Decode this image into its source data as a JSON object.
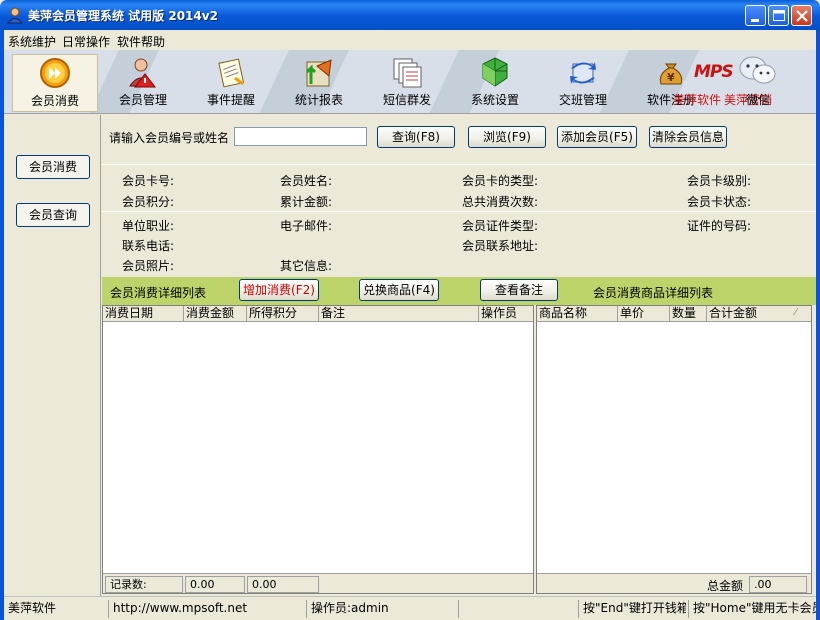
{
  "window": {
    "title": "美萍会员管理系统 试用版  2014v2"
  },
  "menu": [
    "系统维护",
    "日常操作",
    "软件帮助"
  ],
  "toolbar": {
    "buttons": [
      {
        "label": "会员消费",
        "icon": "play-circle-icon"
      },
      {
        "label": "会员管理",
        "icon": "warning-user-icon"
      },
      {
        "label": "事件提醒",
        "icon": "notepad-icon"
      },
      {
        "label": "统计报表",
        "icon": "report-arrow-icon"
      },
      {
        "label": "短信群发",
        "icon": "document-stack-icon"
      },
      {
        "label": "系统设置",
        "icon": "green-cubes-icon"
      },
      {
        "label": "交班管理",
        "icon": "exchange-arrows-icon"
      },
      {
        "label": "软件注册",
        "icon": "money-bag-icon"
      }
    ],
    "brand_logo": "MPS",
    "red_labels": [
      "美萍软件",
      "美萍营销"
    ],
    "wechat_label": "微信"
  },
  "sidebar": {
    "items": [
      "会员消费",
      "会员查询"
    ]
  },
  "search": {
    "label": "请输入会员编号或姓名",
    "value": "",
    "query_btn": "查询(F8)",
    "browse_btn": "浏览(F9)",
    "add_btn": "添加会员(F5)",
    "clear_btn": "清除会员信息"
  },
  "member_fields": {
    "card_no": "会员卡号:",
    "name": "会员姓名:",
    "card_type": "会员卡的类型:",
    "card_level": "会员卡级别:",
    "points": "会员积分:",
    "total_amount": "累计金额:",
    "total_count": "总共消费次数:",
    "card_status": "会员卡状态:",
    "job": "单位职业:",
    "email": "电子邮件:",
    "id_type": "会员证件类型:",
    "id_no": "证件的号码:",
    "phone": "联系电话:",
    "address": "会员联系地址:",
    "photo": "会员照片:",
    "other": "其它信息:"
  },
  "actions": {
    "list_title": "会员消费详细列表",
    "add_consume": "增加消费(F2)",
    "exchange": "兑换商品(F4)",
    "view_notes": "查看备注",
    "goods_title": "会员消费商品详细列表"
  },
  "left_grid": {
    "columns": [
      "消费日期",
      "消费金额",
      "所得积分",
      "备注",
      "操作员"
    ],
    "footer": {
      "label": "记录数:",
      "amount": "0.00",
      "points": "0.00"
    }
  },
  "right_grid": {
    "columns": [
      "商品名称",
      "单价",
      "数量",
      "合计金额"
    ],
    "footer": {
      "label": "总金额",
      "amount": ".00"
    }
  },
  "statusbar": {
    "company": "美萍软件",
    "url": "http://www.mpsoft.net",
    "operator": "操作员:admin",
    "blank": "",
    "hint1": "按\"End\"键打开钱箱",
    "hint2": "按\"Home\"键用无卡会员"
  },
  "colors": {
    "titlebar": "#0858d8",
    "green_band": "#bcd46a",
    "toolbar_bg": "#d8dfe8"
  }
}
